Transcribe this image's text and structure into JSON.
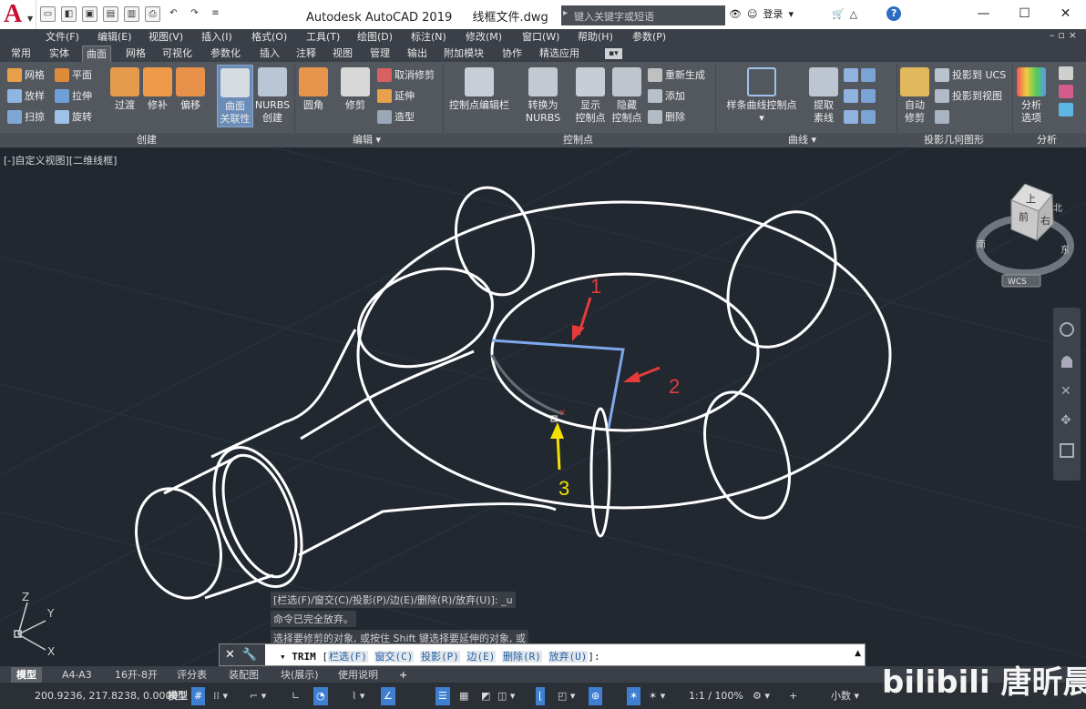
{
  "window": {
    "title": "Autodesk AutoCAD 2019",
    "file": "线框文件.dwg"
  },
  "search": {
    "placeholder": "键入关键字或短语"
  },
  "user": {
    "login": "登录"
  },
  "menubar": [
    "文件(F)",
    "编辑(E)",
    "视图(V)",
    "插入(I)",
    "格式(O)",
    "工具(T)",
    "绘图(D)",
    "标注(N)",
    "修改(M)",
    "窗口(W)",
    "帮助(H)",
    "参数(P)"
  ],
  "ribbon_tabs": [
    "常用",
    "实体",
    "曲面",
    "网格",
    "可视化",
    "参数化",
    "插入",
    "注释",
    "视图",
    "管理",
    "输出",
    "附加模块",
    "协作",
    "精选应用"
  ],
  "active_tab": "曲面",
  "ribbon": {
    "create": {
      "mesh": "网格",
      "loft": "放样",
      "sweep": "扫掠",
      "plane": "平面",
      "extrude": "拉伸",
      "revolve": "旋转",
      "blend": "过渡",
      "patch": "修补",
      "offset": "偏移",
      "assoc1": "曲面",
      "assoc2": "关联性",
      "nurbs1": "NURBS",
      "nurbs2": "创建",
      "label": "创建"
    },
    "edit": {
      "fillet": "圆角",
      "trim": "修剪",
      "untrim": "取消修剪",
      "extend": "延伸",
      "sculpt": "造型",
      "label": "编辑"
    },
    "cv": {
      "cvbar": "控制点编辑栏",
      "convert1": "转换为",
      "convert2": "NURBS",
      "show1": "显示",
      "show2": "控制点",
      "hide1": "隐藏",
      "hide2": "控制点",
      "rebuild": "重新生成",
      "add": "添加",
      "remove": "删除",
      "label": "控制点"
    },
    "curves": {
      "spline1": "样条曲线控制点",
      "extract1": "提取",
      "extract2": "素线",
      "label": "曲线"
    },
    "project": {
      "auto1": "自动",
      "auto2": "修剪",
      "to_ucs": "投影到 UCS",
      "to_view": "投影到视图",
      "label": "投影几何图形"
    },
    "analysis": {
      "options1": "分析",
      "options2": "选项",
      "label": "分析"
    }
  },
  "viewport": {
    "label": "[-]自定义视图][二维线框]"
  },
  "annotations": {
    "a1": "1",
    "a2": "2",
    "a3": "3"
  },
  "viewcube": {
    "top": "上",
    "right": "右",
    "front": "前",
    "north": "北",
    "south": "南",
    "east": "东",
    "wcs": "WCS"
  },
  "ucs": {
    "x": "X",
    "y": "Y",
    "z": "Z"
  },
  "command": {
    "history": [
      "[栏选(F)/窗交(C)/投影(P)/边(E)/删除(R)/放弃(U)]:  _u",
      "命令已完全放弃。",
      "选择要修剪的对象, 或按住 Shift 键选择要延伸的对象, 或"
    ],
    "name": "TRIM",
    "bracket_open": "[",
    "bracket_close": "]:",
    "options": [
      "栏选(F)",
      "窗交(C)",
      "投影(P)",
      "边(E)",
      "删除(R)",
      "放弃(U)"
    ]
  },
  "layout_tabs": [
    "模型",
    "A4-A3",
    "16开-8开",
    "评分表",
    "装配图",
    "块(展示)",
    "使用说明"
  ],
  "status": {
    "coords": "200.9236, 217.8238, 0.0000",
    "model": "模型",
    "scale": "1:1 / 100%",
    "units": "小数"
  },
  "watermark": "bilibili 唐昕晨"
}
